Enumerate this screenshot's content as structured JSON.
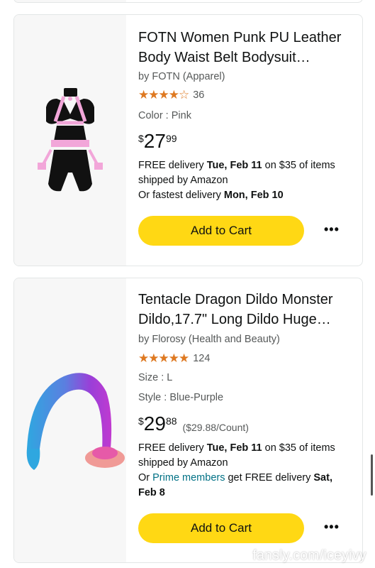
{
  "products": [
    {
      "title_line1": "FOTN Women Punk PU Leather",
      "title_line2": "Body Waist Belt Bodysuit…",
      "brand": "by FOTN (Apparel)",
      "rating": 3.5,
      "stars_glyphs": "★★★★☆",
      "review_count": "36",
      "attr1": "Color : Pink",
      "price_symbol": "$",
      "price_whole": "27",
      "price_fraction": "99",
      "delivery_l1_pre": "FREE delivery ",
      "delivery_l1_date": "Tue, Feb 11",
      "delivery_l1_post": " on $35 of items",
      "delivery_l2": "shipped by Amazon",
      "delivery_l3_pre": "Or fastest delivery ",
      "delivery_l3_date": "Mon, Feb 10",
      "button_label": "Add to Cart",
      "more_label": "•••",
      "image_icon": "harness-bodysuit-image"
    },
    {
      "title_line1": "Tentacle Dragon Dildo Monster",
      "title_line2": "Dildo,17.7\" Long Dildo Huge…",
      "brand": "by Florosy (Health and Beauty)",
      "rating": 4.5,
      "stars_glyphs": "★★★★★",
      "review_count": "124",
      "attr1": "Size : L",
      "attr2": "Style : Blue-Purple",
      "price_symbol": "$",
      "price_whole": "29",
      "price_fraction": "88",
      "unit_price": "($29.88/Count)",
      "delivery_l1_pre": "FREE delivery ",
      "delivery_l1_date": "Tue, Feb 11",
      "delivery_l1_post": " on $35 of items",
      "delivery_l2": "shipped by Amazon",
      "delivery_l3_pre": "Or ",
      "delivery_l3_link": "Prime members",
      "delivery_l3_post": " get FREE delivery ",
      "delivery_l3_date": "Sat,",
      "delivery_l4_date": "Feb 8",
      "button_label": "Add to Cart",
      "more_label": "•••",
      "image_icon": "tentacle-product-image"
    }
  ],
  "watermark": "fansly.com/iceyivy",
  "colors": {
    "star": "#de7921",
    "button": "#ffd814",
    "link": "#007185",
    "muted": "#565959"
  }
}
